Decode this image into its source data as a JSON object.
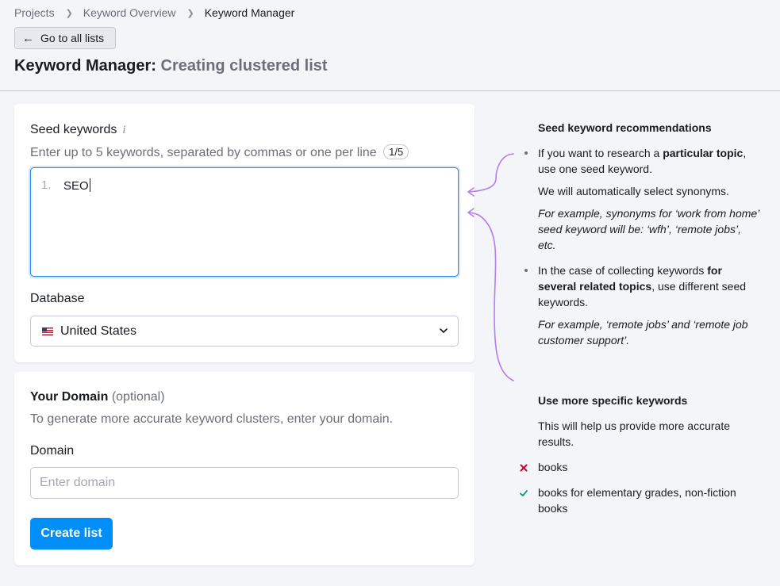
{
  "breadcrumb": {
    "items": [
      "Projects",
      "Keyword Overview",
      "Keyword Manager"
    ]
  },
  "header": {
    "back_label": "Go to all lists",
    "title_main": "Keyword Manager:",
    "title_sub": "Creating clustered list"
  },
  "seed": {
    "label": "Seed keywords",
    "info_icon": "i",
    "hint": "Enter up to 5 keywords, separated by commas or one per line",
    "counter": "1/5",
    "line_number": "1.",
    "value": "SEO"
  },
  "database": {
    "label": "Database",
    "selected": "United States"
  },
  "domain_card": {
    "title": "Your Domain",
    "title_note": "(optional)",
    "description": "To generate more accurate keyword clusters, enter your domain.",
    "field_label": "Domain",
    "placeholder": "Enter domain",
    "submit_label": "Create list"
  },
  "tips": {
    "heading1": "Seed keyword recommendations",
    "b1_pre": "If you want to research a ",
    "b1_bold": "particular topic",
    "b1_post": ", use one seed keyword.",
    "b1_p2": "We will automatically select synonyms.",
    "b1_example": "For example, synonyms for ‘work from home’ seed keyword will be: ‘wfh’, ‘remote jobs’, etc.",
    "b2_pre": "In the case of collecting keywords ",
    "b2_bold": "for several related topics",
    "b2_post": ", use different seed keywords.",
    "b2_example": "For example, ‘remote jobs’ and ‘remote job customer support’.",
    "heading2": "Use more specific keywords",
    "p2": "This will help us provide more accurate results.",
    "bad_example": "books",
    "good_example": "books for elementary grades, non-fiction books"
  },
  "colors": {
    "primary": "#008ff8",
    "focus_border": "#2b8ce6",
    "annotation_arrow": "#b57cf0",
    "error_mark": "#d1002f",
    "success_mark": "#009f81"
  },
  "icons": {
    "breadcrumb_separator": "chevron-right-icon",
    "back": "arrow-left-icon",
    "dropdown": "chevron-down-icon",
    "bad": "cross-icon",
    "good": "check-icon",
    "flag": "us-flag-icon"
  }
}
